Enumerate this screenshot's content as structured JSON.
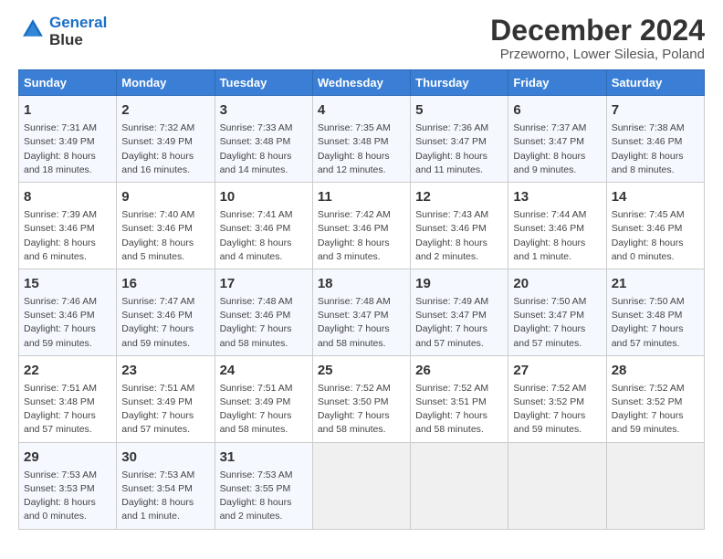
{
  "logo": {
    "line1": "General",
    "line2": "Blue"
  },
  "title": "December 2024",
  "subtitle": "Przeworno, Lower Silesia, Poland",
  "days_header": [
    "Sunday",
    "Monday",
    "Tuesday",
    "Wednesday",
    "Thursday",
    "Friday",
    "Saturday"
  ],
  "weeks": [
    [
      {
        "day": "1",
        "rise": "Sunrise: 7:31 AM",
        "set": "Sunset: 3:49 PM",
        "daylight": "Daylight: 8 hours and 18 minutes."
      },
      {
        "day": "2",
        "rise": "Sunrise: 7:32 AM",
        "set": "Sunset: 3:49 PM",
        "daylight": "Daylight: 8 hours and 16 minutes."
      },
      {
        "day": "3",
        "rise": "Sunrise: 7:33 AM",
        "set": "Sunset: 3:48 PM",
        "daylight": "Daylight: 8 hours and 14 minutes."
      },
      {
        "day": "4",
        "rise": "Sunrise: 7:35 AM",
        "set": "Sunset: 3:48 PM",
        "daylight": "Daylight: 8 hours and 12 minutes."
      },
      {
        "day": "5",
        "rise": "Sunrise: 7:36 AM",
        "set": "Sunset: 3:47 PM",
        "daylight": "Daylight: 8 hours and 11 minutes."
      },
      {
        "day": "6",
        "rise": "Sunrise: 7:37 AM",
        "set": "Sunset: 3:47 PM",
        "daylight": "Daylight: 8 hours and 9 minutes."
      },
      {
        "day": "7",
        "rise": "Sunrise: 7:38 AM",
        "set": "Sunset: 3:46 PM",
        "daylight": "Daylight: 8 hours and 8 minutes."
      }
    ],
    [
      {
        "day": "8",
        "rise": "Sunrise: 7:39 AM",
        "set": "Sunset: 3:46 PM",
        "daylight": "Daylight: 8 hours and 6 minutes."
      },
      {
        "day": "9",
        "rise": "Sunrise: 7:40 AM",
        "set": "Sunset: 3:46 PM",
        "daylight": "Daylight: 8 hours and 5 minutes."
      },
      {
        "day": "10",
        "rise": "Sunrise: 7:41 AM",
        "set": "Sunset: 3:46 PM",
        "daylight": "Daylight: 8 hours and 4 minutes."
      },
      {
        "day": "11",
        "rise": "Sunrise: 7:42 AM",
        "set": "Sunset: 3:46 PM",
        "daylight": "Daylight: 8 hours and 3 minutes."
      },
      {
        "day": "12",
        "rise": "Sunrise: 7:43 AM",
        "set": "Sunset: 3:46 PM",
        "daylight": "Daylight: 8 hours and 2 minutes."
      },
      {
        "day": "13",
        "rise": "Sunrise: 7:44 AM",
        "set": "Sunset: 3:46 PM",
        "daylight": "Daylight: 8 hours and 1 minute."
      },
      {
        "day": "14",
        "rise": "Sunrise: 7:45 AM",
        "set": "Sunset: 3:46 PM",
        "daylight": "Daylight: 8 hours and 0 minutes."
      }
    ],
    [
      {
        "day": "15",
        "rise": "Sunrise: 7:46 AM",
        "set": "Sunset: 3:46 PM",
        "daylight": "Daylight: 7 hours and 59 minutes."
      },
      {
        "day": "16",
        "rise": "Sunrise: 7:47 AM",
        "set": "Sunset: 3:46 PM",
        "daylight": "Daylight: 7 hours and 59 minutes."
      },
      {
        "day": "17",
        "rise": "Sunrise: 7:48 AM",
        "set": "Sunset: 3:46 PM",
        "daylight": "Daylight: 7 hours and 58 minutes."
      },
      {
        "day": "18",
        "rise": "Sunrise: 7:48 AM",
        "set": "Sunset: 3:47 PM",
        "daylight": "Daylight: 7 hours and 58 minutes."
      },
      {
        "day": "19",
        "rise": "Sunrise: 7:49 AM",
        "set": "Sunset: 3:47 PM",
        "daylight": "Daylight: 7 hours and 57 minutes."
      },
      {
        "day": "20",
        "rise": "Sunrise: 7:50 AM",
        "set": "Sunset: 3:47 PM",
        "daylight": "Daylight: 7 hours and 57 minutes."
      },
      {
        "day": "21",
        "rise": "Sunrise: 7:50 AM",
        "set": "Sunset: 3:48 PM",
        "daylight": "Daylight: 7 hours and 57 minutes."
      }
    ],
    [
      {
        "day": "22",
        "rise": "Sunrise: 7:51 AM",
        "set": "Sunset: 3:48 PM",
        "daylight": "Daylight: 7 hours and 57 minutes."
      },
      {
        "day": "23",
        "rise": "Sunrise: 7:51 AM",
        "set": "Sunset: 3:49 PM",
        "daylight": "Daylight: 7 hours and 57 minutes."
      },
      {
        "day": "24",
        "rise": "Sunrise: 7:51 AM",
        "set": "Sunset: 3:49 PM",
        "daylight": "Daylight: 7 hours and 58 minutes."
      },
      {
        "day": "25",
        "rise": "Sunrise: 7:52 AM",
        "set": "Sunset: 3:50 PM",
        "daylight": "Daylight: 7 hours and 58 minutes."
      },
      {
        "day": "26",
        "rise": "Sunrise: 7:52 AM",
        "set": "Sunset: 3:51 PM",
        "daylight": "Daylight: 7 hours and 58 minutes."
      },
      {
        "day": "27",
        "rise": "Sunrise: 7:52 AM",
        "set": "Sunset: 3:52 PM",
        "daylight": "Daylight: 7 hours and 59 minutes."
      },
      {
        "day": "28",
        "rise": "Sunrise: 7:52 AM",
        "set": "Sunset: 3:52 PM",
        "daylight": "Daylight: 7 hours and 59 minutes."
      }
    ],
    [
      {
        "day": "29",
        "rise": "Sunrise: 7:53 AM",
        "set": "Sunset: 3:53 PM",
        "daylight": "Daylight: 8 hours and 0 minutes."
      },
      {
        "day": "30",
        "rise": "Sunrise: 7:53 AM",
        "set": "Sunset: 3:54 PM",
        "daylight": "Daylight: 8 hours and 1 minute."
      },
      {
        "day": "31",
        "rise": "Sunrise: 7:53 AM",
        "set": "Sunset: 3:55 PM",
        "daylight": "Daylight: 8 hours and 2 minutes."
      },
      null,
      null,
      null,
      null
    ]
  ]
}
